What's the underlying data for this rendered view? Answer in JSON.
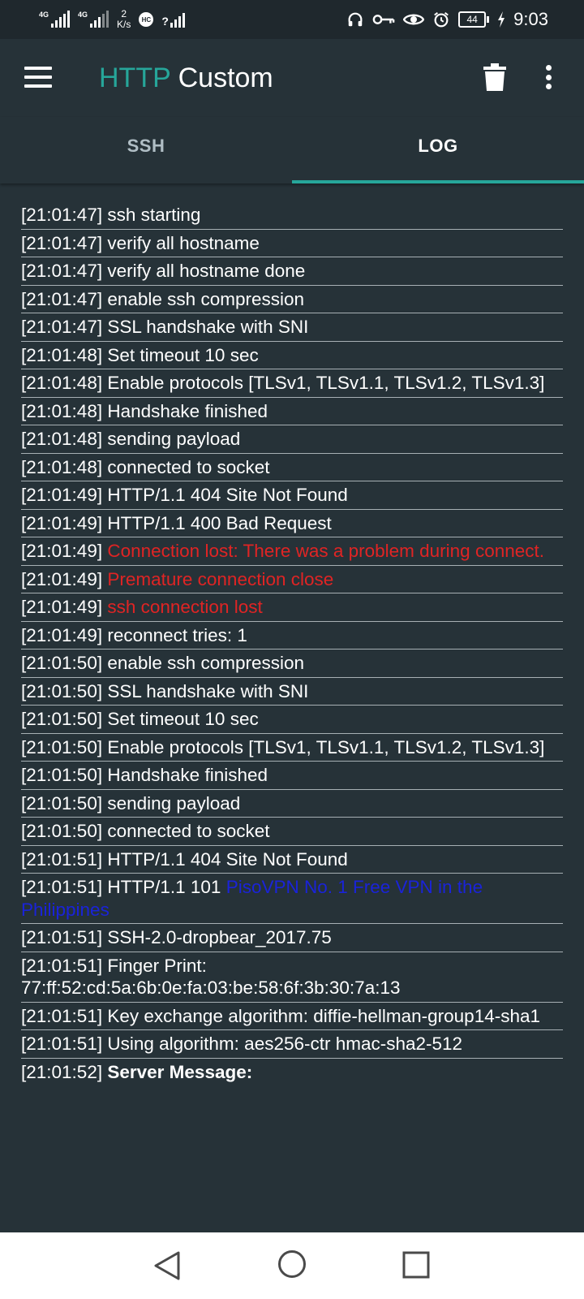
{
  "status_bar": {
    "sim1_label": "4G",
    "sim2_label": "4G",
    "speed_value": "2",
    "speed_unit": "K/s",
    "app_badge": "HC",
    "wifi_label": "?",
    "battery": "44",
    "time": "9:03",
    "icons": [
      "headphones-icon",
      "key-icon",
      "eye-icon",
      "alarm-icon",
      "battery-icon",
      "charging-icon"
    ]
  },
  "app_bar": {
    "title_accent": "HTTP",
    "title_rest": " Custom",
    "icons": [
      "menu-icon",
      "trash-icon",
      "more-vert-icon"
    ]
  },
  "tabs": [
    {
      "label": "SSH",
      "active": false
    },
    {
      "label": "LOG",
      "active": true
    }
  ],
  "colors": {
    "background": "#263238",
    "accent": "#26a69a",
    "error": "#e02424",
    "link": "#1a23d9"
  },
  "log": [
    {
      "time": "[21:01:47]",
      "text": "ssh starting"
    },
    {
      "time": "[21:01:47]",
      "text": "verify all hostname"
    },
    {
      "time": "[21:01:47]",
      "text": "verify all hostname done"
    },
    {
      "time": "[21:01:47]",
      "text": "enable ssh compression"
    },
    {
      "time": "[21:01:47]",
      "text": "SSL handshake with SNI"
    },
    {
      "time": "[21:01:48]",
      "text": "Set timeout 10 sec"
    },
    {
      "time": "[21:01:48]",
      "text": "Enable protocols [TLSv1, TLSv1.1, TLSv1.2, TLSv1.3]"
    },
    {
      "time": "[21:01:48]",
      "text": "Handshake finished"
    },
    {
      "time": "[21:01:48]",
      "text": "sending payload"
    },
    {
      "time": "[21:01:48]",
      "text": "connected to socket"
    },
    {
      "time": "[21:01:49]",
      "text": "HTTP/1.1 404 Site Not Found"
    },
    {
      "time": "[21:01:49]",
      "text": "HTTP/1.1 400 Bad Request"
    },
    {
      "time": "[21:01:49]",
      "text": "",
      "highlight": "Connection lost: There was a problem during connect.",
      "style": "red"
    },
    {
      "time": "[21:01:49]",
      "text": "",
      "highlight": "Premature connection close",
      "style": "red"
    },
    {
      "time": "[21:01:49]",
      "text": "",
      "highlight": "ssh connection lost",
      "style": "red"
    },
    {
      "time": "[21:01:49]",
      "text": "reconnect tries: 1"
    },
    {
      "time": "[21:01:50]",
      "text": "enable ssh compression"
    },
    {
      "time": "[21:01:50]",
      "text": "SSL handshake with SNI"
    },
    {
      "time": "[21:01:50]",
      "text": "Set timeout 10 sec"
    },
    {
      "time": "[21:01:50]",
      "text": "Enable protocols [TLSv1, TLSv1.1, TLSv1.2, TLSv1.3]"
    },
    {
      "time": "[21:01:50]",
      "text": "Handshake finished"
    },
    {
      "time": "[21:01:50]",
      "text": "sending payload"
    },
    {
      "time": "[21:01:50]",
      "text": "connected to socket"
    },
    {
      "time": "[21:01:51]",
      "text": "HTTP/1.1 404 Site Not Found"
    },
    {
      "time": "[21:01:51]",
      "text": "HTTP/1.1 101",
      "highlight": "PisoVPN No. 1 Free VPN in the Philippines",
      "style": "blue"
    },
    {
      "time": "[21:01:51]",
      "text": "SSH-2.0-dropbear_2017.75"
    },
    {
      "time": "[21:01:51]",
      "text": "Finger Print: 77:ff:52:cd:5a:6b:0e:fa:03:be:58:6f:3b:30:7a:13"
    },
    {
      "time": "[21:01:51]",
      "text": "Key exchange algorithm: diffie-hellman-group14-sha1"
    },
    {
      "time": "[21:01:51]",
      "text": "Using algorithm: aes256-ctr hmac-sha2-512"
    },
    {
      "time": "[21:01:52]",
      "text": "",
      "highlight": "Server Message:",
      "style": "bold"
    }
  ],
  "nav_bar": {
    "icons": [
      "back-icon",
      "home-icon",
      "recents-icon"
    ]
  }
}
